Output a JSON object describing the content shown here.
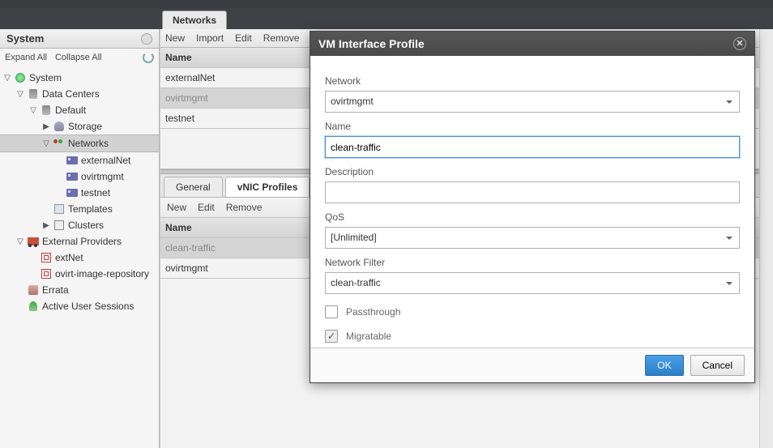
{
  "tab": {
    "label": "Networks"
  },
  "sidebar": {
    "title": "System",
    "expand": "Expand All",
    "collapse": "Collapse All",
    "items": {
      "system": "System",
      "datacenters": "Data Centers",
      "default": "Default",
      "storage": "Storage",
      "networks": "Networks",
      "externalNet": "externalNet",
      "ovirtmgmt": "ovirtmgmt",
      "testnet": "testnet",
      "templates": "Templates",
      "clusters": "Clusters",
      "extprov": "External Providers",
      "extNet": "extNet",
      "ovirtRepo": "ovirt-image-repository",
      "errata": "Errata",
      "activeSessions": "Active User Sessions"
    }
  },
  "actions": {
    "new": "New",
    "import": "Import",
    "edit": "Edit",
    "remove": "Remove"
  },
  "grid": {
    "header": "Name",
    "rows": [
      "externalNet",
      "ovirtmgmt",
      "testnet"
    ]
  },
  "subtabs": {
    "general": "General",
    "vnic": "vNIC Profiles"
  },
  "subactions": {
    "new": "New",
    "edit": "Edit",
    "remove": "Remove"
  },
  "subgrid": {
    "header": "Name",
    "rows": [
      "clean-traffic",
      "ovirtmgmt"
    ]
  },
  "modal": {
    "title": "VM Interface Profile",
    "network_lbl": "Network",
    "network_val": "ovirtmgmt",
    "name_lbl": "Name",
    "name_val": "clean-traffic",
    "desc_lbl": "Description",
    "desc_val": "",
    "qos_lbl": "QoS",
    "qos_val": "[Unlimited]",
    "filter_lbl": "Network Filter",
    "filter_val": "clean-traffic",
    "passthrough": "Passthrough",
    "migratable": "Migratable",
    "ok": "OK",
    "cancel": "Cancel"
  }
}
